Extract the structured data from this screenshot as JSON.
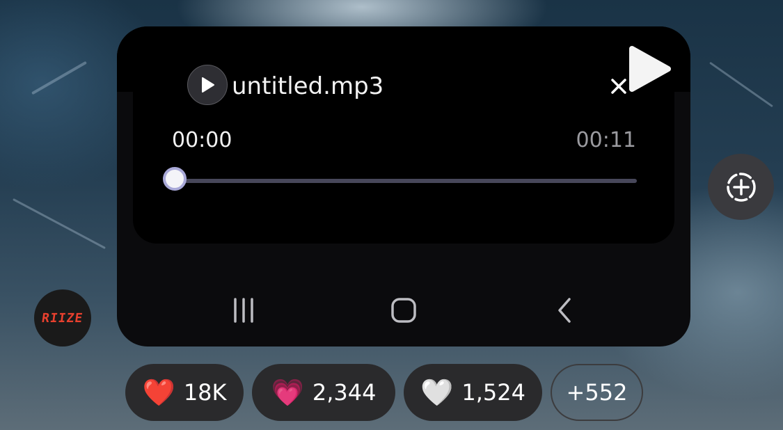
{
  "player": {
    "filename": "untitled.mp3",
    "current_time": "00:00",
    "duration": "00:11",
    "progress": 0
  },
  "nav_bar": {
    "recents": "recents-icon",
    "home": "home-icon",
    "back": "back-icon"
  },
  "profile": {
    "avatar_text": "RIIZE"
  },
  "reactions": [
    {
      "emoji": "❤️",
      "count": "18K"
    },
    {
      "emoji": "💗",
      "count": "2,344"
    },
    {
      "emoji": "🤍",
      "count": "1,524"
    }
  ],
  "more_reactions": "+552",
  "colors": {
    "accent_thumb_border": "#a9a9d8",
    "track": "#47475a",
    "avatar_text": "#e8402e"
  }
}
